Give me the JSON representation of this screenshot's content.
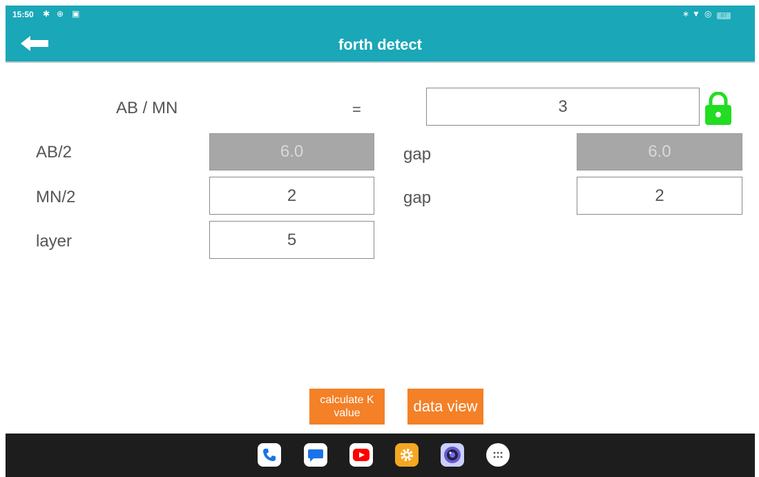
{
  "status_bar": {
    "time": "15:50",
    "battery": "87"
  },
  "app_bar": {
    "title": "forth detect"
  },
  "form": {
    "ratio_label": "AB / MN",
    "equals": "=",
    "ratio_value": "3",
    "ab_label": "AB/2",
    "ab_value": "6.0",
    "ab_gap_label": "gap",
    "ab_gap_value": "6.0",
    "mn_label": "MN/2",
    "mn_value": "2",
    "mn_gap_label": "gap",
    "mn_gap_value": "2",
    "layer_label": "layer",
    "layer_value": "5"
  },
  "buttons": {
    "calculate_line1": "calculate K",
    "calculate_line2": "value",
    "data_view": "data view"
  },
  "colors": {
    "app_bar": "#1aa7b8",
    "button": "#f48027",
    "lock": "#22dd22",
    "disabled_field": "#a7a7a7"
  },
  "icons": [
    "gear-icon",
    "settings-icon",
    "sim-icon",
    "bluetooth-icon",
    "wifi-icon",
    "hotspot-icon",
    "battery-icon",
    "back-arrow-icon",
    "lock-icon",
    "phone-icon",
    "messages-icon",
    "youtube-icon",
    "settings-app-icon",
    "camera-icon",
    "app-drawer-icon"
  ]
}
